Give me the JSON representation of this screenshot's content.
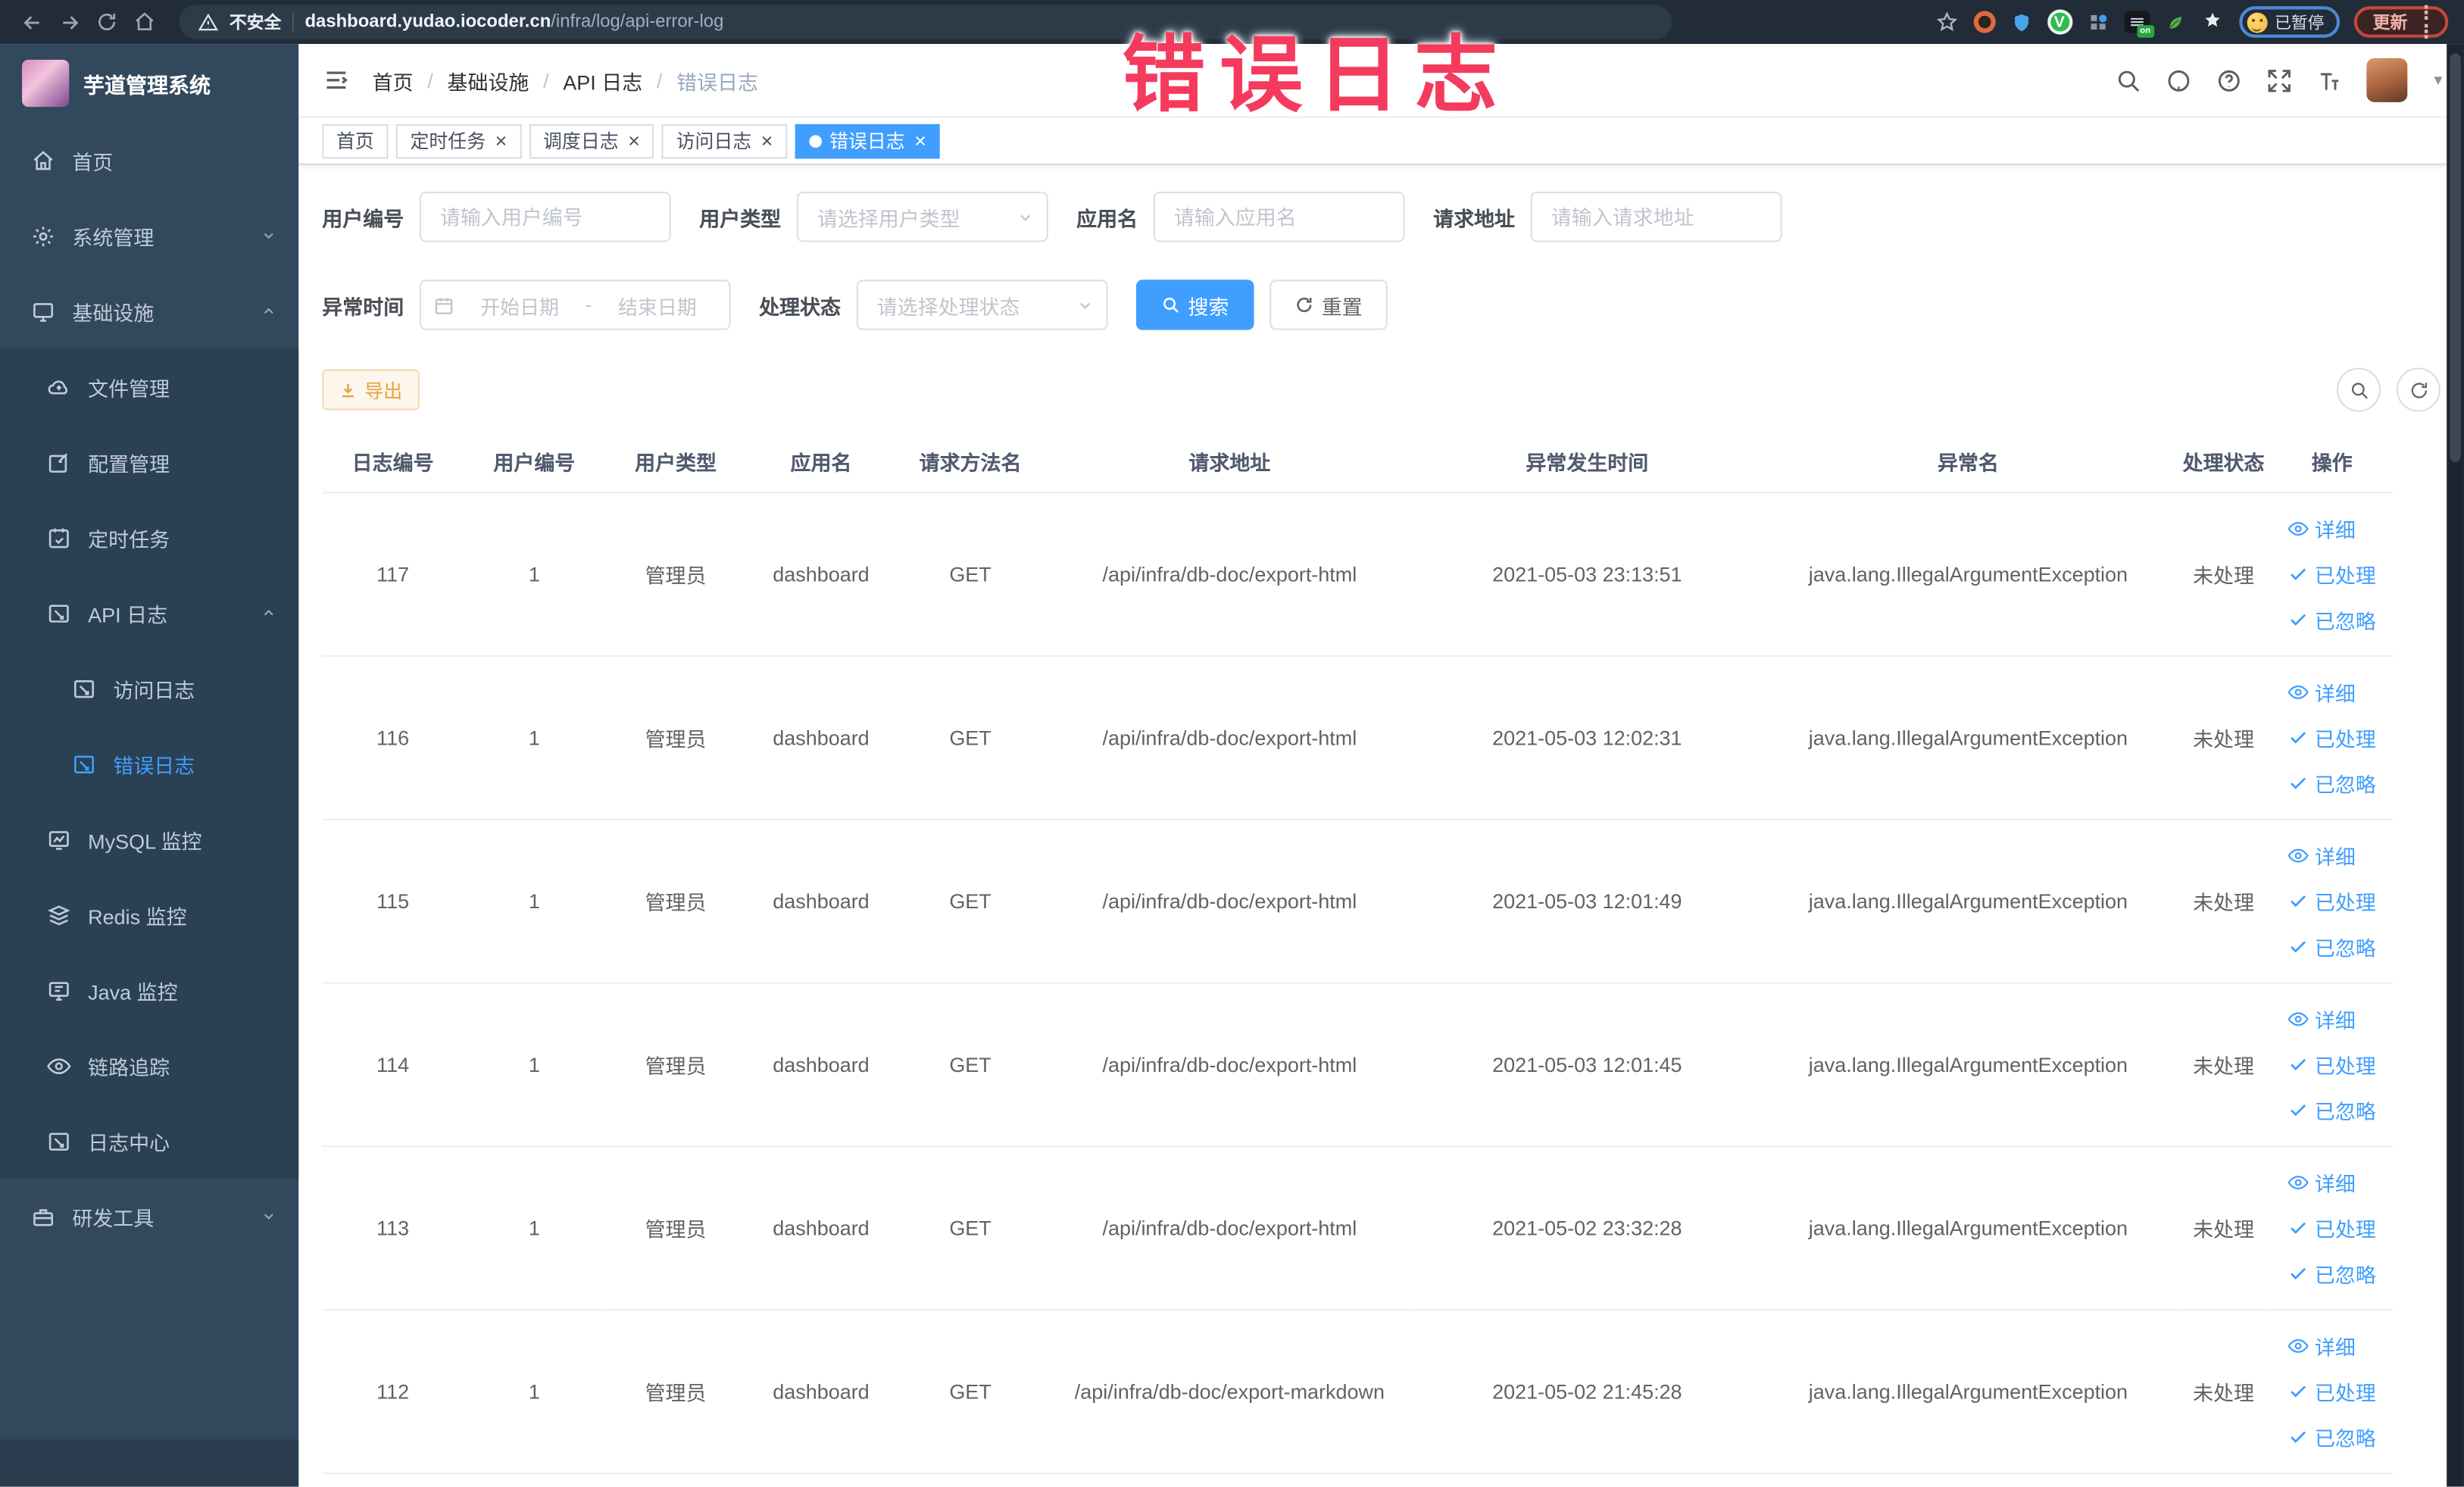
{
  "browser": {
    "security_label": "不安全",
    "url_domain": "dashboard.yudao.iocoder.cn",
    "url_path": "/infra/log/api-error-log",
    "profile_chip_label": "已暂停",
    "update_button_label": "更新"
  },
  "annotation": {
    "text": "错误日志"
  },
  "sidebar": {
    "title": "芋道管理系统",
    "menu": [
      {
        "label": "首页"
      },
      {
        "label": "系统管理"
      },
      {
        "label": "基础设施"
      },
      {
        "label": "研发工具"
      }
    ],
    "infra_children": [
      {
        "label": "文件管理"
      },
      {
        "label": "配置管理"
      },
      {
        "label": "定时任务"
      },
      {
        "label": "API 日志"
      },
      {
        "label": "MySQL 监控"
      },
      {
        "label": "Redis 监控"
      },
      {
        "label": "Java 监控"
      },
      {
        "label": "链路追踪"
      },
      {
        "label": "日志中心"
      }
    ],
    "api_log_children": [
      {
        "label": "访问日志"
      },
      {
        "label": "错误日志",
        "active": true
      }
    ]
  },
  "header": {
    "breadcrumb": [
      {
        "label": "首页"
      },
      {
        "label": "基础设施"
      },
      {
        "label": "API 日志"
      },
      {
        "label": "错误日志"
      }
    ]
  },
  "tabs": [
    {
      "label": "首页",
      "closable": false,
      "active": false
    },
    {
      "label": "定时任务",
      "closable": true,
      "active": false
    },
    {
      "label": "调度日志",
      "closable": true,
      "active": false
    },
    {
      "label": "访问日志",
      "closable": true,
      "active": false
    },
    {
      "label": "错误日志",
      "closable": true,
      "active": true
    }
  ],
  "filters": {
    "user_id": {
      "label": "用户编号",
      "placeholder": "请输入用户编号"
    },
    "user_type": {
      "label": "用户类型",
      "placeholder": "请选择用户类型"
    },
    "app_name": {
      "label": "应用名",
      "placeholder": "请输入应用名"
    },
    "request_url": {
      "label": "请求地址",
      "placeholder": "请输入请求地址"
    },
    "exception_time": {
      "label": "异常时间",
      "start_placeholder": "开始日期",
      "separator": "-",
      "end_placeholder": "结束日期"
    },
    "process_status": {
      "label": "处理状态",
      "placeholder": "请选择处理状态"
    },
    "search_button": "搜索",
    "reset_button": "重置"
  },
  "toolbar": {
    "export_button": "导出"
  },
  "table": {
    "columns": [
      "日志编号",
      "用户编号",
      "用户类型",
      "应用名",
      "请求方法名",
      "请求地址",
      "异常发生时间",
      "异常名",
      "处理状态",
      "操作"
    ],
    "actions": {
      "detail": "详细",
      "processed": "已处理",
      "ignored": "已忽略"
    },
    "rows": [
      {
        "id": "117",
        "user_id": "1",
        "user_type": "管理员",
        "app_name": "dashboard",
        "method": "GET",
        "url": "/api/infra/db-doc/export-html",
        "time": "2021-05-03 23:13:51",
        "exception": "java.lang.IllegalArgumentException",
        "status": "未处理"
      },
      {
        "id": "116",
        "user_id": "1",
        "user_type": "管理员",
        "app_name": "dashboard",
        "method": "GET",
        "url": "/api/infra/db-doc/export-html",
        "time": "2021-05-03 12:02:31",
        "exception": "java.lang.IllegalArgumentException",
        "status": "未处理"
      },
      {
        "id": "115",
        "user_id": "1",
        "user_type": "管理员",
        "app_name": "dashboard",
        "method": "GET",
        "url": "/api/infra/db-doc/export-html",
        "time": "2021-05-03 12:01:49",
        "exception": "java.lang.IllegalArgumentException",
        "status": "未处理"
      },
      {
        "id": "114",
        "user_id": "1",
        "user_type": "管理员",
        "app_name": "dashboard",
        "method": "GET",
        "url": "/api/infra/db-doc/export-html",
        "time": "2021-05-03 12:01:45",
        "exception": "java.lang.IllegalArgumentException",
        "status": "未处理"
      },
      {
        "id": "113",
        "user_id": "1",
        "user_type": "管理员",
        "app_name": "dashboard",
        "method": "GET",
        "url": "/api/infra/db-doc/export-html",
        "time": "2021-05-02 23:32:28",
        "exception": "java.lang.IllegalArgumentException",
        "status": "未处理"
      },
      {
        "id": "112",
        "user_id": "1",
        "user_type": "管理员",
        "app_name": "dashboard",
        "method": "GET",
        "url": "/api/infra/db-doc/export-markdown",
        "time": "2021-05-02 21:45:28",
        "exception": "java.lang.IllegalArgumentException",
        "status": "未处理"
      }
    ]
  },
  "colors": {
    "accent": "#409eff",
    "annotation": "#f43b5e",
    "warning": "#e6a23c",
    "sidebar_bg": "#32485c"
  }
}
